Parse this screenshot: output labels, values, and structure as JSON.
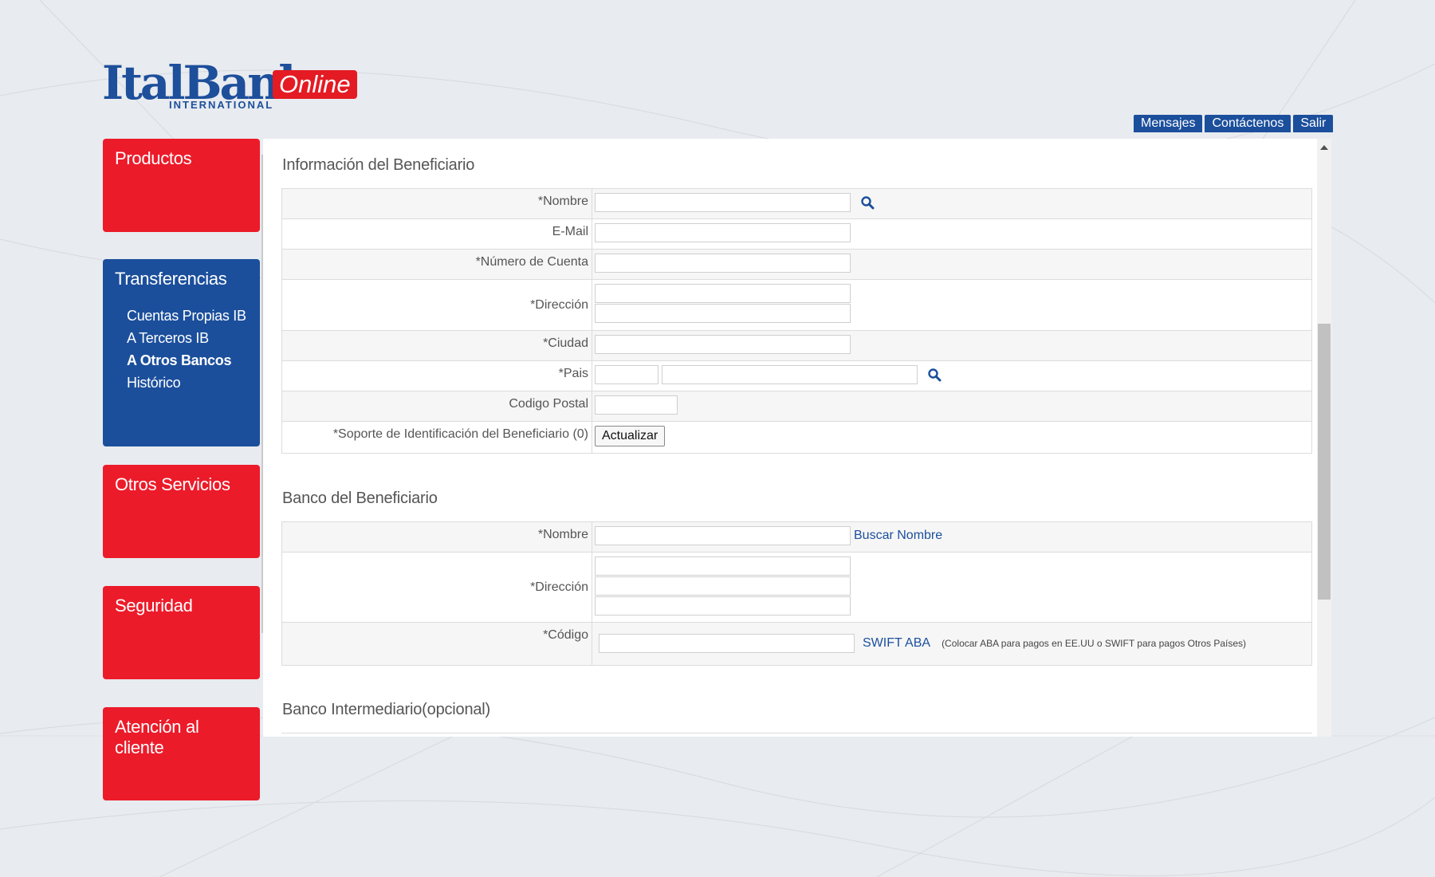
{
  "brand": {
    "name": "ItalBank",
    "badge": "Online",
    "sub": "INTERNATIONAL"
  },
  "topnav": [
    "Mensajes",
    "Contáctenos",
    "Salir"
  ],
  "sidebar": {
    "productos": "Productos",
    "transferencias": {
      "title": "Transferencias",
      "items": [
        "Cuentas Propias IB",
        "A Terceros IB",
        "A Otros Bancos",
        "Histórico"
      ],
      "active": "A Otros Bancos"
    },
    "otros": "Otros Servicios",
    "seguridad": "Seguridad",
    "atencion": "Atención al cliente"
  },
  "beneficiario": {
    "title": "Información del Beneficiario",
    "fields": {
      "nombre": "*Nombre",
      "email": "E-Mail",
      "cuenta": "*Número de Cuenta",
      "direccion": "*Dirección",
      "ciudad": "*Ciudad",
      "pais": "*Pais",
      "postal": "Codigo Postal",
      "soporte": "*Soporte de Identificación del Beneficiario (0)"
    },
    "actualizar": "Actualizar"
  },
  "banco": {
    "title": "Banco del Beneficiario",
    "fields": {
      "nombre": "*Nombre",
      "direccion": "*Dirección",
      "codigo": "*Código"
    },
    "buscar": "Buscar Nombre",
    "swift_aba": "SWIFT ABA",
    "note": "(Colocar ABA para pagos en EE.UU o SWIFT para pagos Otros Países)"
  },
  "intermediario": {
    "title": "Banco Intermediario(opcional)"
  },
  "colors": {
    "red": "#ec1b2a",
    "blue": "#1b4f9c"
  }
}
